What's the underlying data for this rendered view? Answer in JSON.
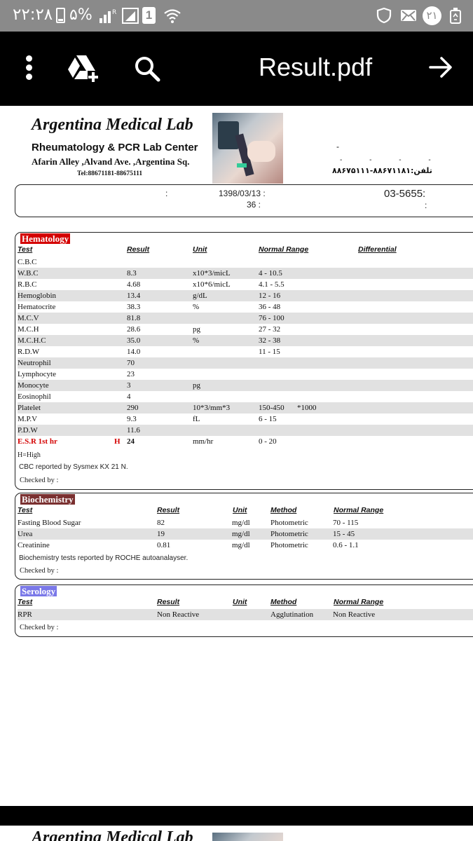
{
  "status_bar": {
    "time": "۲۲:۲۸",
    "battery": "۵%",
    "sim": "1",
    "notification_count": "۲۱"
  },
  "app_bar": {
    "title": "Result.pdf"
  },
  "lab": {
    "name": "Argentina Medical Lab",
    "subtitle": "Rheumatology & PCR Lab Center",
    "address": "Afarin Alley ,Alvand Ave. ,Argentina Sq.",
    "tel": "Tel:88671181-88675111",
    "fa_dash": "-",
    "fa_dots": "- - - -",
    "fa_tel": "تلفن:۸۸۶۷۱۱۸۱-۸۸۶۷۵۱۱۱"
  },
  "patient": {
    "colon1": ":",
    "date": "1398/03/13 :",
    "age": "36 :",
    "id": "03-5655:",
    "colon2": ":"
  },
  "hematology": {
    "title": "Hematology",
    "headers": [
      "Test",
      "Result",
      "Unit",
      "Normal Range",
      "Differential"
    ],
    "rows": [
      {
        "test": "C.B.C",
        "flag": "",
        "result": "",
        "unit": "",
        "range": "",
        "extra": ""
      },
      {
        "test": "W.B.C",
        "flag": "",
        "result": "8.3",
        "unit": "x10*3/micL",
        "range": "4 - 10.5",
        "extra": ""
      },
      {
        "test": "R.B.C",
        "flag": "",
        "result": "4.68",
        "unit": "x10*6/micL",
        "range": "4.1 - 5.5",
        "extra": ""
      },
      {
        "test": "Hemoglobin",
        "flag": "",
        "result": "13.4",
        "unit": "g/dL",
        "range": "12 - 16",
        "extra": ""
      },
      {
        "test": "Hematocrite",
        "flag": "",
        "result": "38.3",
        "unit": "%",
        "range": "36 - 48",
        "extra": ""
      },
      {
        "test": "M.C.V",
        "flag": "",
        "result": "81.8",
        "unit": "",
        "range": "76 - 100",
        "extra": ""
      },
      {
        "test": "M.C.H",
        "flag": "",
        "result": "28.6",
        "unit": "pg",
        "range": "27 - 32",
        "extra": ""
      },
      {
        "test": "M.C.H.C",
        "flag": "",
        "result": "35.0",
        "unit": "%",
        "range": "32 - 38",
        "extra": ""
      },
      {
        "test": "R.D.W",
        "flag": "",
        "result": "14.0",
        "unit": "",
        "range": "11 - 15",
        "extra": ""
      },
      {
        "test": "Neutrophil",
        "flag": "",
        "result": "70",
        "unit": "",
        "range": "",
        "extra": ""
      },
      {
        "test": "Lymphocyte",
        "flag": "",
        "result": "23",
        "unit": "",
        "range": "",
        "extra": ""
      },
      {
        "test": "Monocyte",
        "flag": "",
        "result": "3",
        "unit": "pg",
        "range": "",
        "extra": ""
      },
      {
        "test": "Eosinophil",
        "flag": "",
        "result": "4",
        "unit": "",
        "range": "",
        "extra": ""
      },
      {
        "test": "Platelet",
        "flag": "",
        "result": "290",
        "unit": "10*3/mm*3",
        "range": "150-450",
        "extra": "*1000"
      },
      {
        "test": "M.P.V",
        "flag": "",
        "result": "9.3",
        "unit": "fL",
        "range": "6 - 15",
        "extra": ""
      },
      {
        "test": "P.D.W",
        "flag": "",
        "result": "11.6",
        "unit": "",
        "range": "",
        "extra": ""
      },
      {
        "test": "E.S.R 1st hr",
        "flag": "H",
        "result": "24",
        "unit": "mm/hr",
        "range": "0 - 20",
        "extra": ""
      }
    ],
    "legend": "H=High",
    "note": "CBC reported by  Sysmex KX 21 N.",
    "checked": "Checked by :"
  },
  "biochemistry": {
    "title": "Biochemistry",
    "headers": [
      "Test",
      "Result",
      "Unit",
      "Method",
      "Normal Range"
    ],
    "rows": [
      {
        "test": "Fasting Blood Sugar",
        "result": "82",
        "unit": "mg/dl",
        "method": "Photometric",
        "range": "70 - 115"
      },
      {
        "test": "Urea",
        "result": "19",
        "unit": "mg/dl",
        "method": "Photometric",
        "range": "15 - 45"
      },
      {
        "test": "Creatinine",
        "result": "0.81",
        "unit": "mg/dl",
        "method": "Photometric",
        "range": "0.6 - 1.1"
      }
    ],
    "note": "Biochemistry tests reported by ROCHE autoanalayser.",
    "checked": "Checked by :"
  },
  "serology": {
    "title": "Serology",
    "headers": [
      "Test",
      "Result",
      "Unit",
      "Method",
      "Normal Range"
    ],
    "rows": [
      {
        "test": "RPR",
        "result": "Non Reactive",
        "unit": "",
        "method": "Agglutination",
        "range": "Non Reactive"
      }
    ],
    "checked": "Checked by :"
  },
  "page2": {
    "title": "Argentina Medical Lab"
  },
  "colors": {
    "hematology_label": "#d40000",
    "biochemistry_label": "#7a3030",
    "serology_label": "#7a78e8",
    "row_shade": "#e1e1e1"
  }
}
